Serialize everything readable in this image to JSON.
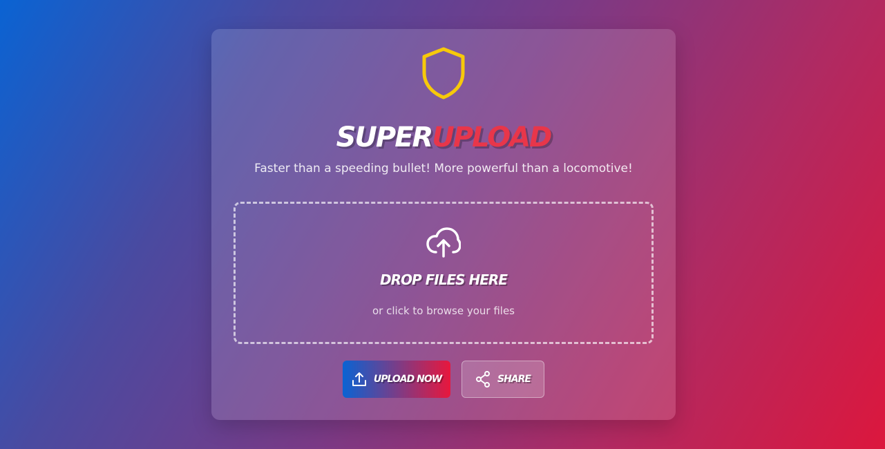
{
  "brand": {
    "title_part1": "SUPER",
    "title_part2": "UPLOAD",
    "tagline": "Faster than a speeding bullet! More powerful than a locomotive!",
    "logo_icon": "shield-icon",
    "colors": {
      "shield": "#f7c90a",
      "title_accent": "#e8364a",
      "gradient_start": "#0a63d3",
      "gradient_end": "#dc173d"
    }
  },
  "dropzone": {
    "icon": "cloud-upload-icon",
    "title": "DROP FILES HERE",
    "subtitle": "or click to browse your files"
  },
  "actions": {
    "upload_label": "UPLOAD NOW",
    "upload_icon": "upload-icon",
    "share_label": "SHARE",
    "share_icon": "share-icon"
  }
}
